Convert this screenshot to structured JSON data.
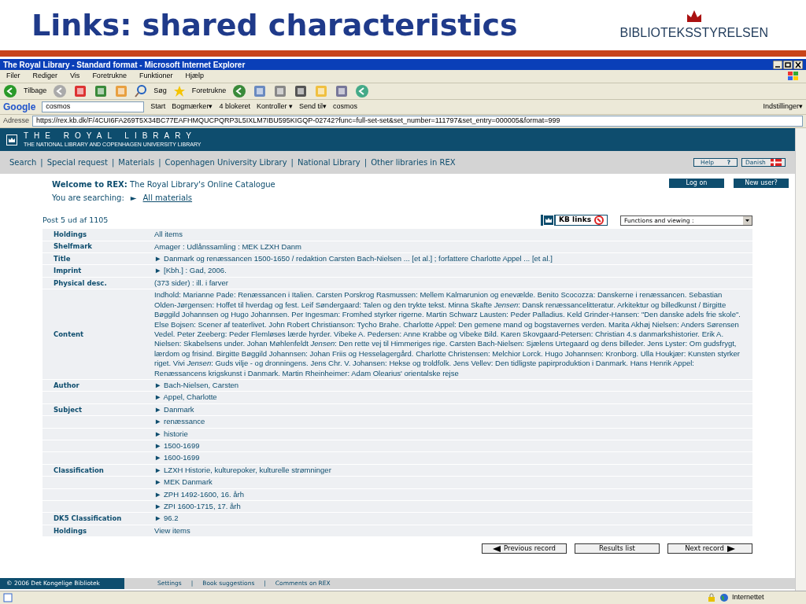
{
  "slide": {
    "title": "Links: shared characteristics",
    "logo_text": "BIBLIOTEKSSTYRELSEN"
  },
  "browser": {
    "title": "The Royal Library - Standard format - Microsoft Internet Explorer",
    "menu": [
      "Filer",
      "Rediger",
      "Vis",
      "Foretrukne",
      "Funktioner",
      "Hjælp"
    ],
    "toolbar": {
      "back": "Tilbage",
      "search": "Søg",
      "favorites": "Foretrukne"
    },
    "google_bar": {
      "logo": "Google",
      "search_value": "cosmos",
      "items": [
        "Start",
        "Bogmærker▾",
        "4 blokeret",
        "Kontroller ▾",
        "Send til▾",
        "cosmos"
      ],
      "settings": "Indstillinger▾"
    },
    "address": {
      "label": "Adresse",
      "url": "https://rex.kb.dk/F/4CUI6FA269T5X34BC77EAFHMQUCPQRP3L5IXLM7IBU595KIGQP-02742?func=full-set-set&set_number=111797&set_entry=000005&format=999"
    }
  },
  "page": {
    "header": {
      "title": "THE ROYAL LIBRARY",
      "subtitle": "THE NATIONAL LIBRARY AND COPENHAGEN UNIVERSITY LIBRARY"
    },
    "nav": {
      "separator": "|",
      "items": [
        "Search",
        "Special request",
        "Materials",
        "Copenhagen University Library",
        "National Library",
        "Other libraries in REX"
      ]
    },
    "help": {
      "label": "Help",
      "mark": "?"
    },
    "language": "Danish",
    "welcome": "**Welcome to REX:** The Royal Library's Online Catalogue",
    "searching": {
      "label": "You are searching:",
      "arrow": "►",
      "link": "All materials"
    },
    "account_buttons": [
      "Log on",
      "New user?"
    ],
    "post": "Post 5 ud af 1105",
    "kb_links": "KB links",
    "functions_select": "Functions and viewing :",
    "rows": [
      {
        "label": "Holdings",
        "value": "All items"
      },
      {
        "label": "Shelfmark",
        "value": "Amager : Udlånssamling : MEK LZXH Danm"
      },
      {
        "label": "Title",
        "value": "► Danmark og renæssancen 1500-1650 / redaktion Carsten Bach-Nielsen ... [et al.] ; forfattere Charlotte Appel ... [et al.]"
      },
      {
        "label": "Imprint",
        "value": "► [Kbh.] : Gad, 2006."
      },
      {
        "label": "Physical desc.",
        "value": "(373 sider)  : ill. i farver"
      },
      {
        "label": "Content",
        "value": "Indhold: Marianne Pade: Renæssancen i Italien. Carsten Porskrog Rasmussen: Mellem Kalmarunion og enevælde. Benito Scocozza: Danskerne i renæssancen. Sebastian Olden-Jørgensen: Hoffet til hverdag og fest. Leif Søndergaard: Talen og den trykte tekst. Minna Skafte *Jensen*: Dansk renæssancelitteratur. Arkitektur og billedkunst / Birgitte Bøggild Johannsen og Hugo Johannsen. Per Ingesman: Fromhed styrker rigerne. Martin Schwarz Lausten: Peder Palladius. Keld Grinder-Hansen: \"Den danske adels frie skole\". Else Bojsen: Scener af teaterlivet. John Robert Christianson: Tycho Brahe. Charlotte Appel: Den gemene mand og bogstavernes verden. Marita Akhøj Nielsen: Anders Sørensen Vedel. Peter Zeeberg: Peder Flemløses lærde hyrder. Vibeke A. Pedersen: Anne Krabbe og Vibeke Bild. Karen Skovgaard-Petersen: Christian 4.s danmarkshistorier. Erik A. Nielsen: Skabelsens under. Johan Møhlenfeldt *Jensen*: Den rette vej til Himmeriges rige. Carsten Bach-Nielsen: Sjælens Urtegaard og dens billeder. Jens Lyster: Om gudsfrygt, lærdom og frisind. Birgitte Bøggild Johannsen: Johan Friis og Hesselagergård. Charlotte Christensen: Melchior Lorck. Hugo Johannsen: Kronborg. Ulla Houkjær: Kunsten styrker riget. Vivi *Jensen*: Guds vilje - og dronningens. Jens Chr. V. Johansen: Hekse og troldfolk. Jens Vellev: Den tidligste papirproduktion i Danmark. Hans Henrik Appel: Renæssancens krigskunst i Danmark. Martin Rheinheimer: Adam Olearius' orientalske rejse"
      },
      {
        "label": "Author",
        "value": "► Bach-Nielsen, Carsten"
      },
      {
        "value": "► Appel, Charlotte"
      },
      {
        "label": "Subject",
        "value": "► Danmark"
      },
      {
        "value": "► renæssance"
      },
      {
        "value": "► historie"
      },
      {
        "value": "► 1500-1699"
      },
      {
        "value": "► 1600-1699"
      },
      {
        "label": "Classification",
        "value": "► LZXH Historie, kulturepoker, kulturelle strømninger"
      },
      {
        "value": "► MEK Danmark"
      },
      {
        "value": "► ZPH 1492-1600, 16. årh"
      },
      {
        "value": "► ZPI 1600-1715, 17. årh"
      },
      {
        "label": "DK5 Classification",
        "value": "► 96.2"
      },
      {
        "label": "Holdings",
        "value": "View items"
      }
    ],
    "record_buttons": [
      {
        "label": "Previous record",
        "kind": "previous"
      },
      {
        "label": "Results list",
        "kind": "list"
      },
      {
        "label": "Next record",
        "kind": "next"
      }
    ],
    "footer": {
      "copyright": "© 2006 Det Kongelige Bibliotek",
      "separator": "|",
      "links": [
        "Settings",
        "Book suggestions",
        "Comments on REX"
      ]
    }
  },
  "status_bar": {
    "zone": "Internettet"
  }
}
